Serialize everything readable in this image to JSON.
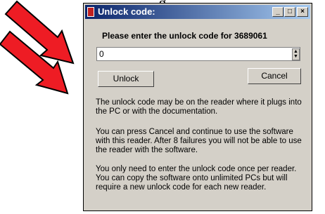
{
  "window": {
    "title": "Unlock code:",
    "minimize_glyph": "_",
    "maximize_glyph": "□",
    "close_glyph": "×"
  },
  "prompt": "Please enter the unlock code for 3689061",
  "input": {
    "value": "0"
  },
  "buttons": {
    "unlock_label": "Unlock",
    "cancel_label": "Cancel"
  },
  "paragraphs": [
    "The unlock code may be on the reader where it plugs into the PC or with the documentation.",
    "You can press Cancel and continue to use the software with this reader. After 8 failures you will not be able to use the reader with the software.",
    "You only need to enter the unlock code once per reader. You can copy the software onto unlimited PCs but will require a new unlock code for each new reader."
  ],
  "icons": [
    "arrow-icon",
    "app-icon",
    "spin-icon"
  ],
  "colors": {
    "arrow": "#ee1c24",
    "titlebar": "#0a246a",
    "dialog": "#d4d0c8"
  }
}
